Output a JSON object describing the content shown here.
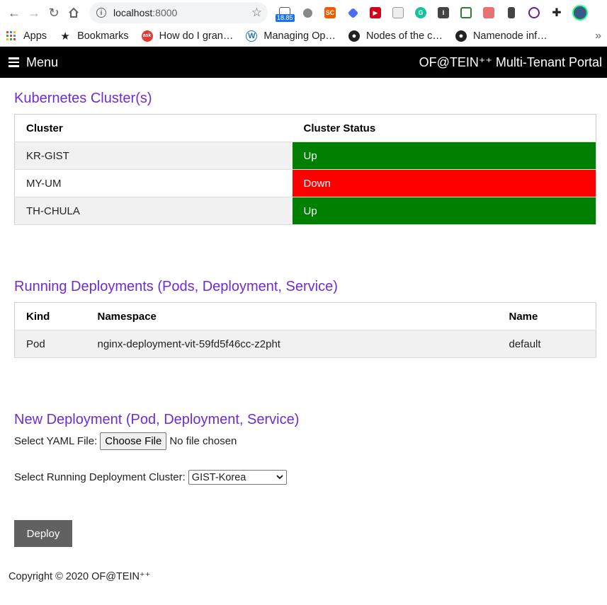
{
  "browser": {
    "url_host": "localhost",
    "url_port": ":8000",
    "ext_badge": "18.85",
    "ext_sc": "SC",
    "ext_i": "I"
  },
  "bookmarks": [
    {
      "label": "Apps"
    },
    {
      "label": "Bookmarks"
    },
    {
      "label": "How do I gran…"
    },
    {
      "label": "Managing Op…"
    },
    {
      "label": "Nodes of the c…"
    },
    {
      "label": "Namenode inf…"
    }
  ],
  "navbar": {
    "menu_label": "Menu",
    "brand": "OF@TEIN⁺⁺ Multi-Tenant Portal"
  },
  "clusters": {
    "heading": "Kubernetes Cluster(s)",
    "columns": [
      "Cluster",
      "Cluster Status"
    ],
    "rows": [
      {
        "cluster": "KR-GIST",
        "status": "Up",
        "color": "#008000"
      },
      {
        "cluster": "MY-UM",
        "status": "Down",
        "color": "#ff0000"
      },
      {
        "cluster": "TH-CHULA",
        "status": "Up",
        "color": "#008000"
      }
    ]
  },
  "deployments": {
    "heading": "Running Deployments (Pods, Deployment, Service)",
    "columns": [
      "Kind",
      "Namespace",
      "Name"
    ],
    "rows": [
      {
        "kind": "Pod",
        "namespace": "nginx-deployment-vit-59fd5f46cc-z2pht",
        "name": "default"
      }
    ]
  },
  "new_deployment": {
    "heading": "New Deployment (Pod, Deployment, Service)",
    "yaml_label": "Select YAML File:",
    "file_button": "Choose File",
    "file_status": "No file chosen",
    "cluster_label": "Select Running Deployment Cluster:",
    "cluster_selected": "GIST-Korea",
    "deploy_label": "Deploy"
  },
  "footer": {
    "copyright": "Copyright © 2020 OF@TEIN⁺⁺"
  }
}
